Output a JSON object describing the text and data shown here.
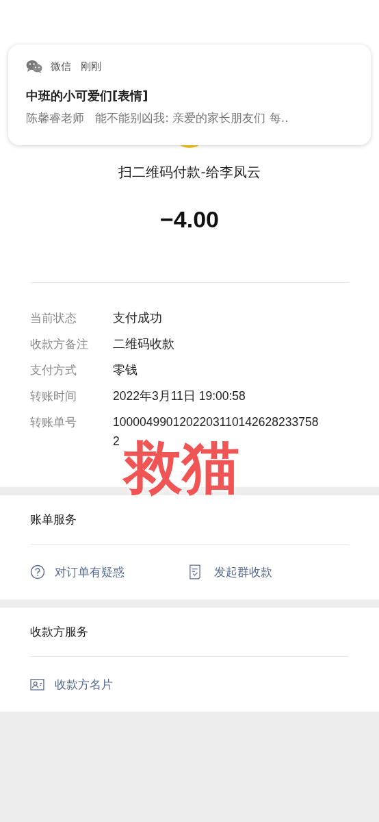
{
  "notification": {
    "app": "微信",
    "time": "刚刚",
    "title": "中班的小可爱们[表情]",
    "body": "陈馨睿老师   能不能别凶我: 亲爱的家长朋友们 每.."
  },
  "payment": {
    "title": "扫二维码付款-给李凤云",
    "amount": "−4.00"
  },
  "details": [
    {
      "label": "当前状态",
      "value": "支付成功"
    },
    {
      "label": "收款方备注",
      "value": "二维码收款"
    },
    {
      "label": "支付方式",
      "value": "零钱"
    },
    {
      "label": "转账时间",
      "value": "2022年3月11日 19:00:58"
    },
    {
      "label": "转账单号",
      "value": "10000499012022031101426282337582"
    }
  ],
  "stamp": "救猫",
  "sections": [
    {
      "title": "账单服务",
      "items": [
        {
          "kind": "question",
          "label": "对订单有疑惑"
        },
        {
          "kind": "bill",
          "label": "发起群收款"
        }
      ]
    },
    {
      "title": "收款方服务",
      "items": [
        {
          "kind": "card",
          "label": "收款方名片"
        }
      ]
    }
  ]
}
